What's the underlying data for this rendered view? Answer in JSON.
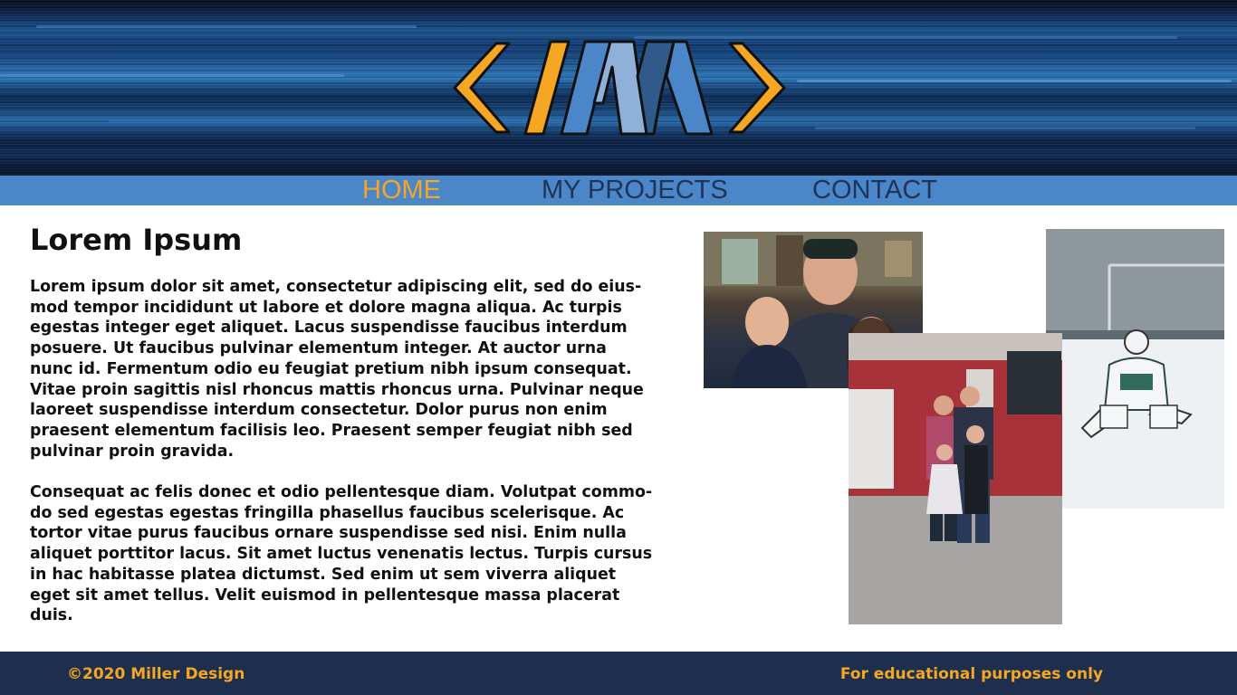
{
  "brand": {
    "logo_icon": "miller-design-logo-icon",
    "colors": {
      "accent_orange": "#f5a623",
      "nav_blue": "#4a86c8",
      "nav_text": "#1f3557",
      "footer_bg": "#1d2f4d",
      "logo_blue_light": "#8fb0d8",
      "logo_blue_mid": "#4a86c8",
      "logo_blue_dark": "#2f5a8a"
    }
  },
  "nav": {
    "items": [
      {
        "label": "HOME",
        "active": true
      },
      {
        "label": "MY PROJECTS",
        "active": false
      },
      {
        "label": "CONTACT",
        "active": false
      }
    ]
  },
  "main": {
    "heading": "Lorem Ipsum",
    "paragraphs": [
      "Lorem ipsum dolor sit amet, consectetur adipiscing elit, sed do eius-mod tempor incididunt ut labore et dolore magna aliqua. Ac turpis egestas integer eget aliquet. Lacus suspendisse faucibus interdum posuere. Ut faucibus pulvinar elementum integer. At auctor urna nunc id. Fermentum odio eu feugiat pretium nibh ipsum consequat. Vitae proin sagittis nisl rhoncus mattis rhoncus urna. Pulvinar neque laoreet suspendisse interdum consectetur. Dolor purus non enim praesent elementum facilisis leo. Praesent semper feugiat nibh sed pulvinar proin gravida.",
      "Consequat ac felis donec et odio pellentesque diam. Volutpat commo-do sed egestas egestas fringilla phasellus faucibus scelerisque. Ac tortor vitae purus faucibus ornare suspendisse sed nisi. Enim nulla aliquet porttitor lacus. Sit amet luctus venenatis lectus. Turpis cursus in hac habitasse platea dictumst. Sed enim ut sem viverra aliquet eget sit amet tellus. Velit euismod in pellentesque massa placerat duis."
    ]
  },
  "photos": [
    {
      "icon": "family-selfie-photo-icon"
    },
    {
      "icon": "hockey-goalie-photo-icon"
    },
    {
      "icon": "fire-truck-family-photo-icon"
    }
  ],
  "footer": {
    "copyright": "©2020 Miller Design",
    "disclaimer": "For educational purposes only"
  }
}
